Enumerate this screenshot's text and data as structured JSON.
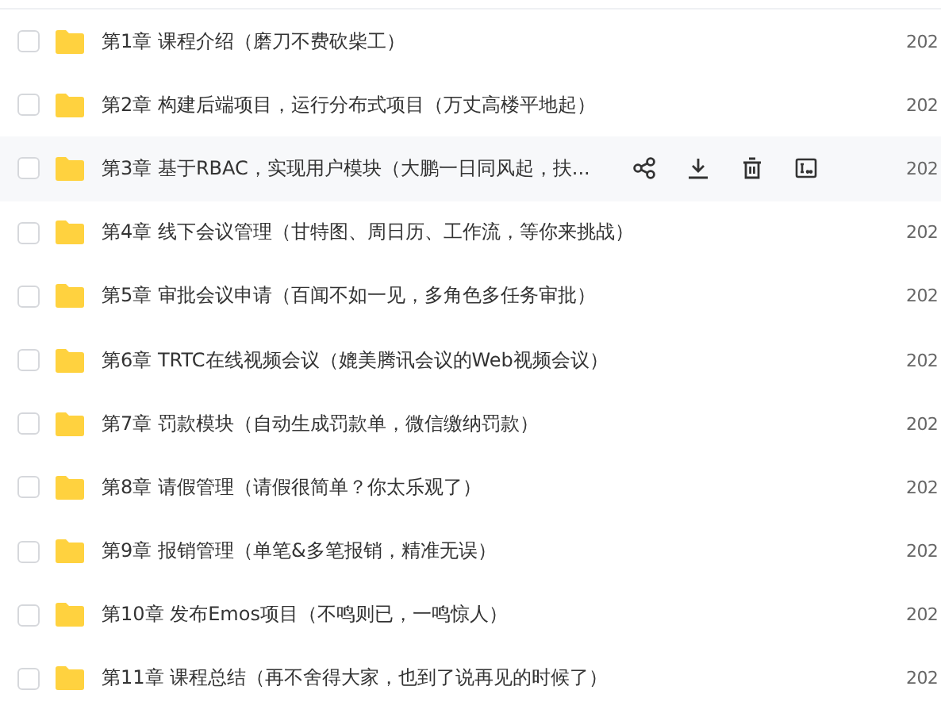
{
  "files": [
    {
      "name": "第1章 课程介绍（磨刀不费砍柴工）",
      "date": "202",
      "checked": false,
      "hovered": false
    },
    {
      "name": "第2章 构建后端项目，运行分布式项目（万丈高楼平地起）",
      "date": "202",
      "checked": false,
      "hovered": false
    },
    {
      "name": "第3章 基于RBAC，实现用户模块（大鹏一日同风起，扶...",
      "date": "202",
      "checked": false,
      "hovered": true
    },
    {
      "name": "第4章 线下会议管理（甘特图、周日历、工作流，等你来挑战）",
      "date": "202",
      "checked": false,
      "hovered": false
    },
    {
      "name": "第5章 审批会议申请（百闻不如一见，多角色多任务审批）",
      "date": "202",
      "checked": false,
      "hovered": false
    },
    {
      "name": "第6章 TRTC在线视频会议（媲美腾讯会议的Web视频会议）",
      "date": "202",
      "checked": false,
      "hovered": false
    },
    {
      "name": "第7章 罚款模块（自动生成罚款单，微信缴纳罚款）",
      "date": "202",
      "checked": false,
      "hovered": false
    },
    {
      "name": "第8章 请假管理（请假很简单？你太乐观了）",
      "date": "202",
      "checked": false,
      "hovered": false
    },
    {
      "name": "第9章 报销管理（单笔&多笔报销，精准无误）",
      "date": "202",
      "checked": false,
      "hovered": false
    },
    {
      "name": "第10章 发布Emos项目（不鸣则已，一鸣惊人）",
      "date": "202",
      "checked": false,
      "hovered": false
    },
    {
      "name": "第11章 课程总结（再不舍得大家，也到了说再见的时候了）",
      "date": "202",
      "checked": false,
      "hovered": false
    }
  ]
}
